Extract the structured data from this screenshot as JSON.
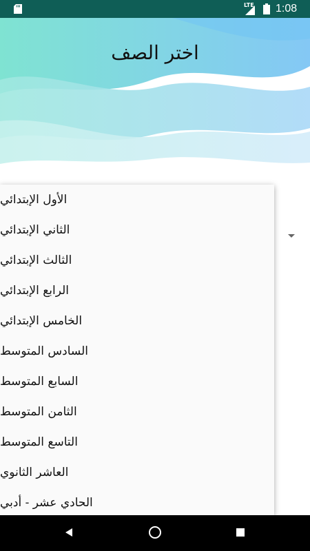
{
  "status_bar": {
    "time": "1:08",
    "network": "LTE",
    "icons": [
      "sd-card-icon",
      "signal-icon",
      "battery-icon"
    ],
    "background_color": "#0f5e56"
  },
  "header": {
    "title": "اختر الصف",
    "wave_colors": [
      "#7ee0d6",
      "#8fd3f5",
      "#bfe9f5",
      "#e0f7fb"
    ]
  },
  "dropdown": {
    "items": [
      "الأول الإبتدائي",
      "الثاني الإبتدائي",
      "الثالث الإبتدائي",
      "الرابع الإبتدائي",
      "الخامس الإبتدائي",
      "السادس المتوسط",
      "السابع المتوسط",
      "الثامن المتوسط",
      "التاسع المتوسط",
      "العاشر الثانوي",
      "الحادي عشر - أدبي"
    ],
    "arrow_icon": "dropdown-arrow-icon"
  },
  "nav_bar": {
    "buttons": [
      "back-icon",
      "home-icon",
      "recent-apps-icon"
    ]
  }
}
